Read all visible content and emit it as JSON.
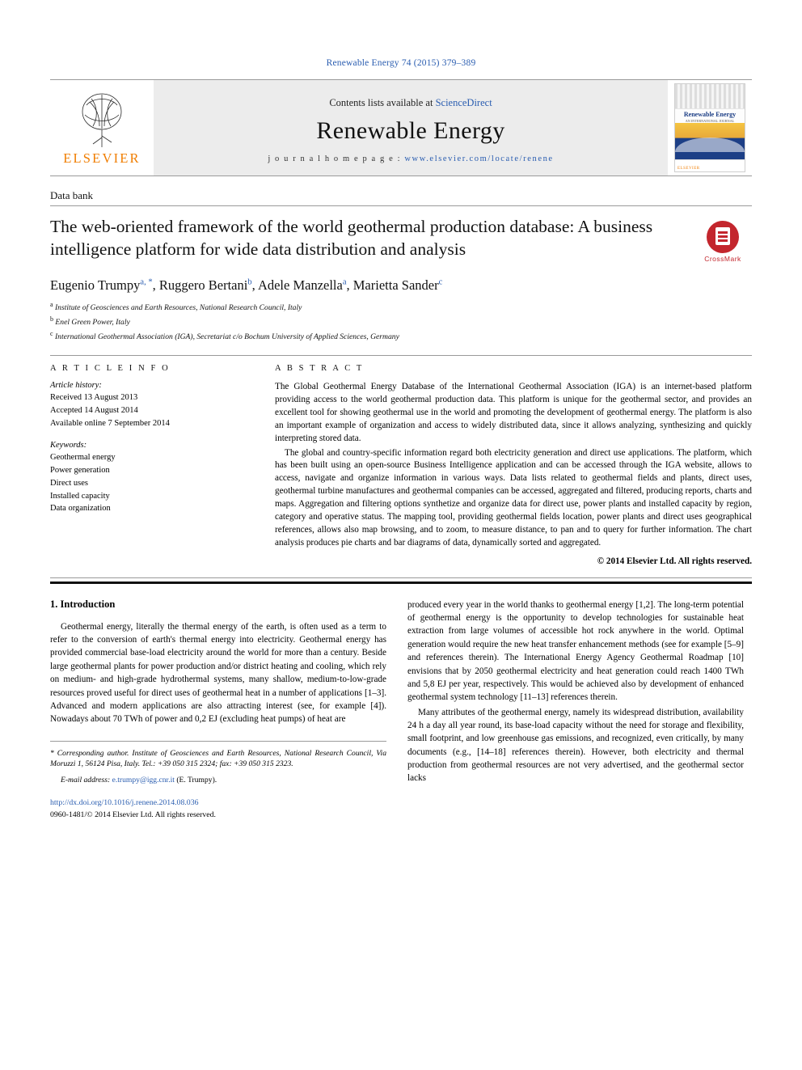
{
  "journal_ref": "Renewable Energy 74 (2015) 379–389",
  "masthead": {
    "publisher": "ELSEVIER",
    "contents_prefix": "Contents lists available at",
    "contents_link": "ScienceDirect",
    "journal_title": "Renewable Energy",
    "homepage_prefix": "j o u r n a l   h o m e p a g e :",
    "homepage_url": "www.elsevier.com/locate/renene",
    "cover": {
      "title": "Renewable Energy",
      "subtitle": "AN INTERNATIONAL JOURNAL",
      "footer_logo": "ELSEVIER"
    }
  },
  "article": {
    "section_label": "Data bank",
    "title": "The web-oriented framework of the world geothermal production database: A business intelligence platform for wide data distribution and analysis",
    "crossmark_label": "CrossMark",
    "authors": [
      {
        "name": "Eugenio Trumpy",
        "marks": "a, *"
      },
      {
        "name": "Ruggero Bertani",
        "marks": "b"
      },
      {
        "name": "Adele Manzella",
        "marks": "a"
      },
      {
        "name": "Marietta Sander",
        "marks": "c"
      }
    ],
    "affiliations": [
      {
        "mark": "a",
        "text": "Institute of Geosciences and Earth Resources, National Research Council, Italy"
      },
      {
        "mark": "b",
        "text": "Enel Green Power, Italy"
      },
      {
        "mark": "c",
        "text": "International Geothermal Association (IGA), Secretariat c/o Bochum University of Applied Sciences, Germany"
      }
    ]
  },
  "article_info": {
    "heading": "A R T I C L E   I N F O",
    "history_label": "Article history:",
    "history": [
      "Received 13 August 2013",
      "Accepted 14 August 2014",
      "Available online 7 September 2014"
    ],
    "keywords_label": "Keywords:",
    "keywords": [
      "Geothermal energy",
      "Power generation",
      "Direct uses",
      "Installed capacity",
      "Data organization"
    ]
  },
  "abstract": {
    "heading": "A B S T R A C T",
    "paragraphs": [
      "The Global Geothermal Energy Database of the International Geothermal Association (IGA) is an internet-based platform providing access to the world geothermal production data. This platform is unique for the geothermal sector, and provides an excellent tool for showing geothermal use in the world and promoting the development of geothermal energy. The platform is also an important example of organization and access to widely distributed data, since it allows analyzing, synthesizing and quickly interpreting stored data.",
      "The global and country-specific information regard both electricity generation and direct use applications. The platform, which has been built using an open-source Business Intelligence application and can be accessed through the IGA website, allows to access, navigate and organize information in various ways. Data lists related to geothermal fields and plants, direct uses, geothermal turbine manufactures and geothermal companies can be accessed, aggregated and filtered, producing reports, charts and maps. Aggregation and filtering options synthetize and organize data for direct use, power plants and installed capacity by region, category and operative status. The mapping tool, providing geothermal fields location, power plants and direct uses geographical references, allows also map browsing, and to zoom, to measure distance, to pan and to query for further information. The chart analysis produces pie charts and bar diagrams of data, dynamically sorted and aggregated."
    ],
    "copyright": "© 2014 Elsevier Ltd. All rights reserved."
  },
  "body": {
    "intro_heading": "1.  Introduction",
    "left_paragraphs": [
      "Geothermal energy, literally the thermal energy of the earth, is often used as a term to refer to the conversion of earth's thermal energy into electricity. Geothermal energy has provided commercial base-load electricity around the world for more than a century. Beside large geothermal plants for power production and/or district heating and cooling, which rely on medium- and high-grade hydrothermal systems, many shallow, medium-to-low-grade resources proved useful for direct uses of geothermal heat in a number of applications [1–3]. Advanced and modern applications are also attracting interest (see, for example [4]). Nowadays about 70 TWh of power and 0,2 EJ (excluding heat pumps) of heat are"
    ],
    "right_paragraphs": [
      "produced every year in the world thanks to geothermal energy [1,2]. The long-term potential of geothermal energy is the opportunity to develop technologies for sustainable heat extraction from large volumes of accessible hot rock anywhere in the world. Optimal generation would require the new heat transfer enhancement methods (see for example [5–9] and references therein). The International Energy Agency Geothermal Roadmap [10] envisions that by 2050 geothermal electricity and heat generation could reach 1400 TWh and 5,8 EJ per year, respectively. This would be achieved also by development of enhanced geothermal system technology [11–13] references therein.",
      "Many attributes of the geothermal energy, namely its widespread distribution, availability 24 h a day all year round, its base-load capacity without the need for storage and flexibility, small footprint, and low greenhouse gas emissions, and recognized, even critically, by many documents (e.g., [14–18] references therein). However, both electricity and thermal production from geothermal resources are not very advertised, and the geothermal sector lacks"
    ],
    "footnote": {
      "text": "* Corresponding author. Institute of Geosciences and Earth Resources, National Research Council, Via Moruzzi 1, 56124 Pisa, Italy. Tel.: +39 050 315 2324; fax: +39 050 315 2323.",
      "email_label": "E-mail address:",
      "email": "e.trumpy@igg.cnr.it",
      "email_suffix": "(E. Trumpy)."
    },
    "doi": "http://dx.doi.org/10.1016/j.renene.2014.08.036",
    "issn_line": "0960-1481/© 2014 Elsevier Ltd. All rights reserved."
  }
}
